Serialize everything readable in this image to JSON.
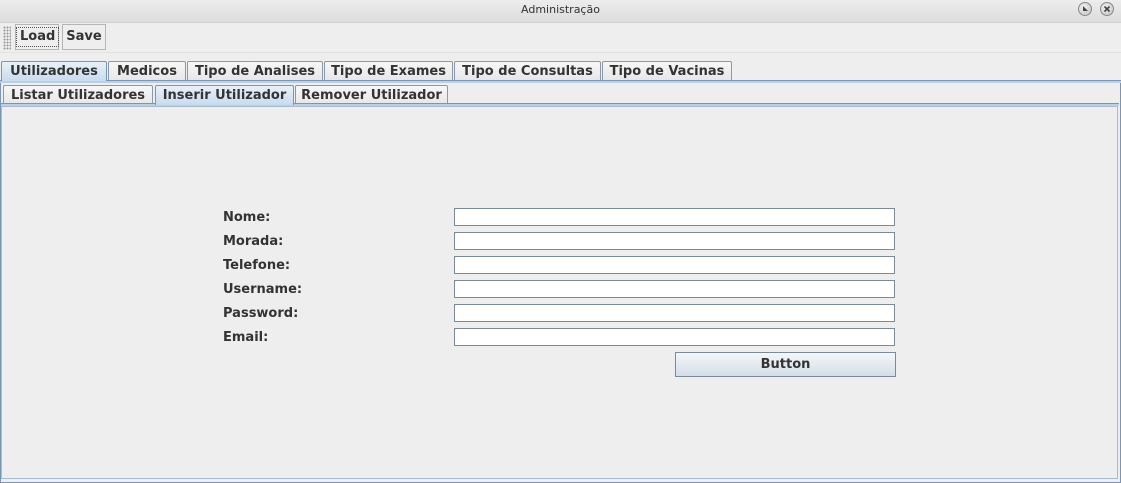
{
  "window": {
    "title": "Administração"
  },
  "toolbar": {
    "load_label": "Load",
    "save_label": "Save"
  },
  "main_tabs": [
    {
      "label": "Utilizadores",
      "selected": true
    },
    {
      "label": "Medicos",
      "selected": false
    },
    {
      "label": "Tipo de Analises",
      "selected": false
    },
    {
      "label": "Tipo de Exames",
      "selected": false
    },
    {
      "label": "Tipo de Consultas",
      "selected": false
    },
    {
      "label": "Tipo de Vacinas",
      "selected": false
    }
  ],
  "sub_tabs": [
    {
      "label": "Listar Utilizadores",
      "selected": false
    },
    {
      "label": "Inserir Utilizador",
      "selected": true
    },
    {
      "label": "Remover Utilizador",
      "selected": false
    }
  ],
  "form": {
    "fields": [
      {
        "label": "Nome:",
        "value": ""
      },
      {
        "label": "Morada:",
        "value": ""
      },
      {
        "label": "Telefone:",
        "value": ""
      },
      {
        "label": "Username:",
        "value": ""
      },
      {
        "label": "Password:",
        "value": ""
      },
      {
        "label": "Email:",
        "value": ""
      }
    ],
    "submit_label": "Button"
  },
  "colors": {
    "background": "#eeeeee",
    "tab_selected": "#c8dbee",
    "border_accent": "#7a96b4"
  }
}
